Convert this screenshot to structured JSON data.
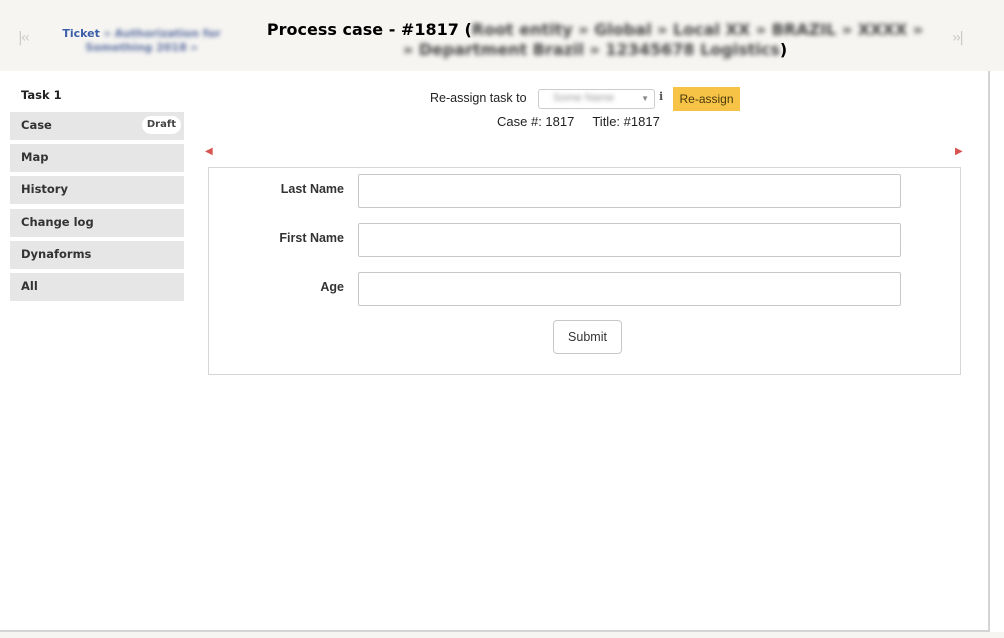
{
  "header": {
    "nav_first_icon": "first-page-icon",
    "nav_first_glyph": "|<<",
    "nav_last_icon": "last-page-icon",
    "nav_last_glyph": ">>|",
    "ticket_label": "Ticket",
    "ticket_blurred_1": "» Authorization for",
    "ticket_blurred_2": "Something 2018 »",
    "title": "Process case - #1817",
    "title_open": "(",
    "title_blurred_1": "Root entity » Global » Local XX » BRAZIL » XXXX »",
    "title_blurred_2": "» Department Brazil » 12345678 Logistics",
    "title_close": ")"
  },
  "sidebar": {
    "task_label": "Task 1",
    "items": [
      {
        "label": "Case",
        "badge": "Draft"
      },
      {
        "label": "Map"
      },
      {
        "label": "History"
      },
      {
        "label": "Change log"
      },
      {
        "label": "Dynaforms"
      },
      {
        "label": "All"
      }
    ]
  },
  "reassign": {
    "label": "Re-assign task to",
    "selected_user": "Some Name",
    "info_glyph": "i",
    "button_label": "Re-assign"
  },
  "case_info": {
    "case_number_label": "Case #: 1817",
    "title_label": "Title: #1817"
  },
  "step_nav": {
    "prev_icon": "previous-step-icon",
    "next_icon": "next-step-icon"
  },
  "form": {
    "fields": [
      {
        "label": "Last Name",
        "value": ""
      },
      {
        "label": "First Name",
        "value": ""
      },
      {
        "label": "Age",
        "value": ""
      }
    ],
    "submit_label": "Submit"
  },
  "colors": {
    "accent_button": "#f6c347",
    "link": "#3a5ea8",
    "sidebar_bg": "#e6e6e6",
    "step_arrow": "#d9534f"
  }
}
